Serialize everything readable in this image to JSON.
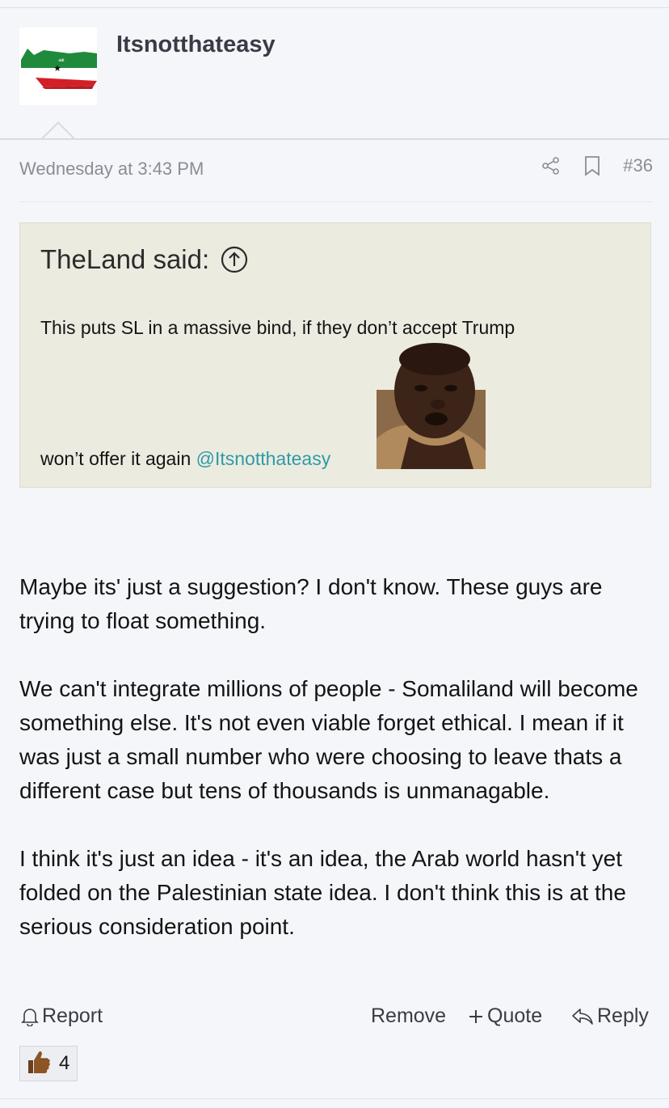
{
  "post": {
    "author": "Itsnotthateasy",
    "timestamp": "Wednesday at 3:43 PM",
    "post_number": "#36"
  },
  "quote": {
    "attribution": "TheLand said:",
    "line1": "This puts SL in a massive bind, if they don’t accept Trump",
    "line2": "won’t offer it again ",
    "mention": "@Itsnotthateasy"
  },
  "body": {
    "p1": "Maybe its' just a suggestion? I don't know. These guys are trying to float something.",
    "p2": "We can't integrate millions of people - Somaliland will become something else. It's not even viable forget ethical. I mean if it was just a small number who were choosing to leave thats a different case but tens of thousands is unmanagable.",
    "p3": "I think it's just an idea - it's an idea, the Arab world hasn't yet folded on the Palestinian state idea. I don't think this is at the serious consideration point."
  },
  "actions": {
    "report": "Report",
    "remove": "Remove",
    "quote": "Quote",
    "reply": "Reply"
  },
  "reactions": {
    "like_count": "4"
  },
  "icons": {
    "share": "share-icon",
    "bookmark": "bookmark-icon",
    "jump": "arrow-up-circle-icon",
    "bell": "bell-icon",
    "plus": "plus-icon",
    "reply": "reply-arrow-icon",
    "like": "thumbs-up-emoji-icon"
  },
  "colors": {
    "background": "#f5f6fa",
    "quote_bg": "#ecebe0",
    "mention": "#2e9ba6",
    "muted": "#8a8d96"
  }
}
